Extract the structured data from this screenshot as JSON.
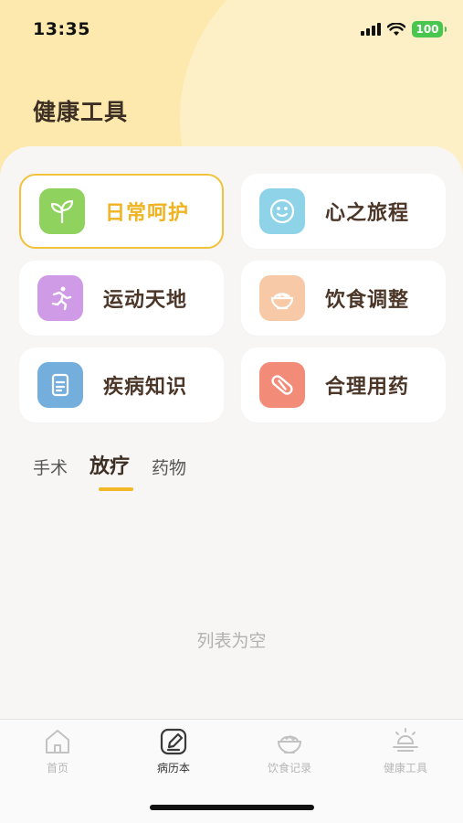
{
  "status_bar": {
    "time": "13:35",
    "battery": "100"
  },
  "header": {
    "title": "健康工具"
  },
  "tools": [
    {
      "label": "日常呵护",
      "icon": "sprout-icon",
      "color": "#8fd25e",
      "active": true
    },
    {
      "label": "心之旅程",
      "icon": "smiley-face-icon",
      "color": "#8ed3e8",
      "active": false
    },
    {
      "label": "运动天地",
      "icon": "running-person-icon",
      "color": "#cf9be6",
      "active": false
    },
    {
      "label": "饮食调整",
      "icon": "rice-bowl-icon",
      "color": "#f7c9a6",
      "active": false
    },
    {
      "label": "疾病知识",
      "icon": "document-icon",
      "color": "#73aedd",
      "active": false
    },
    {
      "label": "合理用药",
      "icon": "pill-icon",
      "color": "#f28b78",
      "active": false
    }
  ],
  "category_tabs": [
    {
      "label": "手术",
      "selected": false
    },
    {
      "label": "放疗",
      "selected": true
    },
    {
      "label": "药物",
      "selected": false
    }
  ],
  "list": {
    "empty_text": "列表为空"
  },
  "tab_bar": [
    {
      "label": "首页",
      "icon": "home-icon",
      "selected": false
    },
    {
      "label": "病历本",
      "icon": "edit-pen-icon",
      "selected": true
    },
    {
      "label": "饮食记录",
      "icon": "rice-bowl-icon",
      "selected": false
    },
    {
      "label": "健康工具",
      "icon": "sunrise-icon",
      "selected": false
    }
  ],
  "colors": {
    "accent": "#f2b82a",
    "header_bg": "#fde9ad",
    "battery": "#49c64d"
  }
}
